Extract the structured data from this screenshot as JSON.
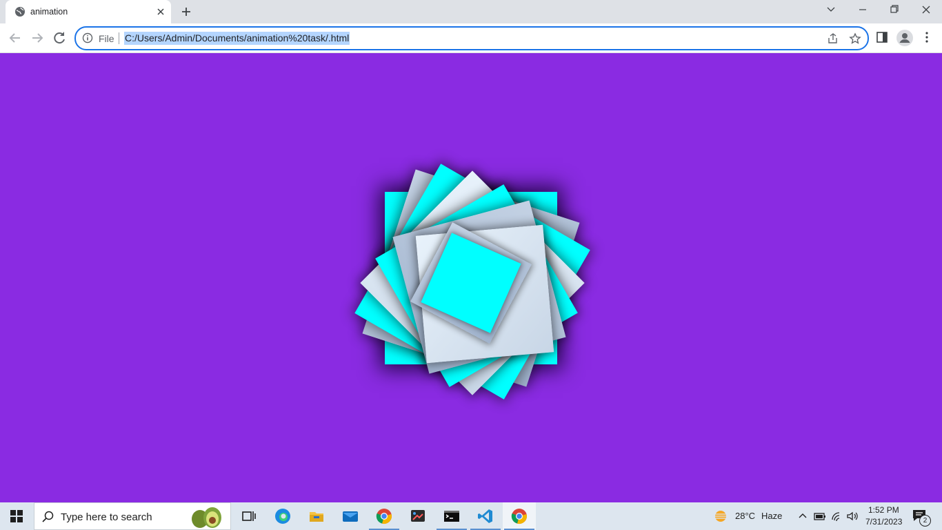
{
  "browser": {
    "tab": {
      "title": "animation",
      "favicon": "globe-icon",
      "close_icon": "close-icon"
    },
    "new_tab_icon": "plus-icon",
    "window_controls": [
      "chevron-down-icon",
      "minimize-icon",
      "restore-icon",
      "close-icon"
    ],
    "toolbar": {
      "back_icon": "back-arrow-icon",
      "forward_icon": "forward-arrow-icon",
      "reload_icon": "reload-icon",
      "omnibox": {
        "info_icon": "info-icon",
        "scheme_label": "File",
        "url": "C:/Users/Admin/Documents/animation%20task/.html",
        "share_icon": "share-icon",
        "bookmark_icon": "star-icon"
      },
      "side_panel_icon": "side-panel-icon",
      "profile_icon": "avatar-icon",
      "menu_icon": "kebab-menu-icon"
    }
  },
  "page": {
    "background_color": "#8a2be2",
    "colors": {
      "cyan": "#00ffff",
      "light": "#e8f2fb",
      "steel": "#b4c4da"
    }
  },
  "taskbar": {
    "start_icon": "windows-logo-icon",
    "search": {
      "placeholder": "Type here to search",
      "icon": "search-icon"
    },
    "apps": [
      "task-view-icon",
      "edge-icon",
      "file-explorer-icon",
      "mail-icon",
      "chrome-icon",
      "snipping-tool-icon",
      "terminal-icon",
      "vscode-icon",
      "chrome-icon"
    ],
    "weather": {
      "temperature": "28°C",
      "condition": "Haze",
      "icon": "haze-icon"
    },
    "tray_icons": [
      "chevron-up-icon",
      "battery-icon",
      "wifi-icon",
      "volume-icon"
    ],
    "clock": {
      "time": "1:52 PM",
      "date": "7/31/2023"
    },
    "notifications": {
      "count": "2",
      "icon": "notification-icon"
    }
  }
}
